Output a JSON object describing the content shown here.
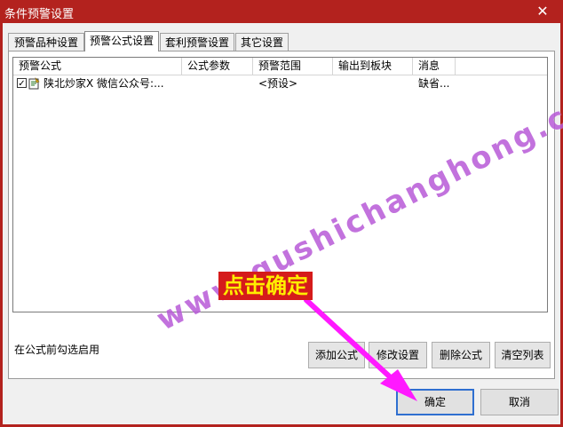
{
  "window": {
    "title": "条件预警设置",
    "close_label": "✕"
  },
  "tabs": [
    {
      "label": "预警品种设置"
    },
    {
      "label": "预警公式设置"
    },
    {
      "label": "套利预警设置"
    },
    {
      "label": "其它设置"
    }
  ],
  "table": {
    "columns": [
      "预警公式",
      "公式参数",
      "预警范围",
      "输出到板块",
      "消息"
    ],
    "rows": [
      {
        "checked": true,
        "formula": "陕北炒家X 微信公众号:...",
        "params": "",
        "range": "<预设>",
        "block": "",
        "message": "缺省..."
      }
    ]
  },
  "footer": {
    "hint": "在公式前勾选启用",
    "buttons": [
      "添加公式",
      "修改设置",
      "删除公式",
      "清空列表"
    ]
  },
  "dialog_buttons": {
    "ok": "确定",
    "cancel": "取消"
  },
  "overlay": {
    "annotation": "点击确定",
    "watermark": "www.gushichanghong.com",
    "arrow_color": "#ff19ff",
    "annotation_bg": "#d51b1b",
    "annotation_text_color": "#ffee00"
  },
  "colors": {
    "titlebar": "#b3221e",
    "default_button_border": "#2f6fd0"
  }
}
